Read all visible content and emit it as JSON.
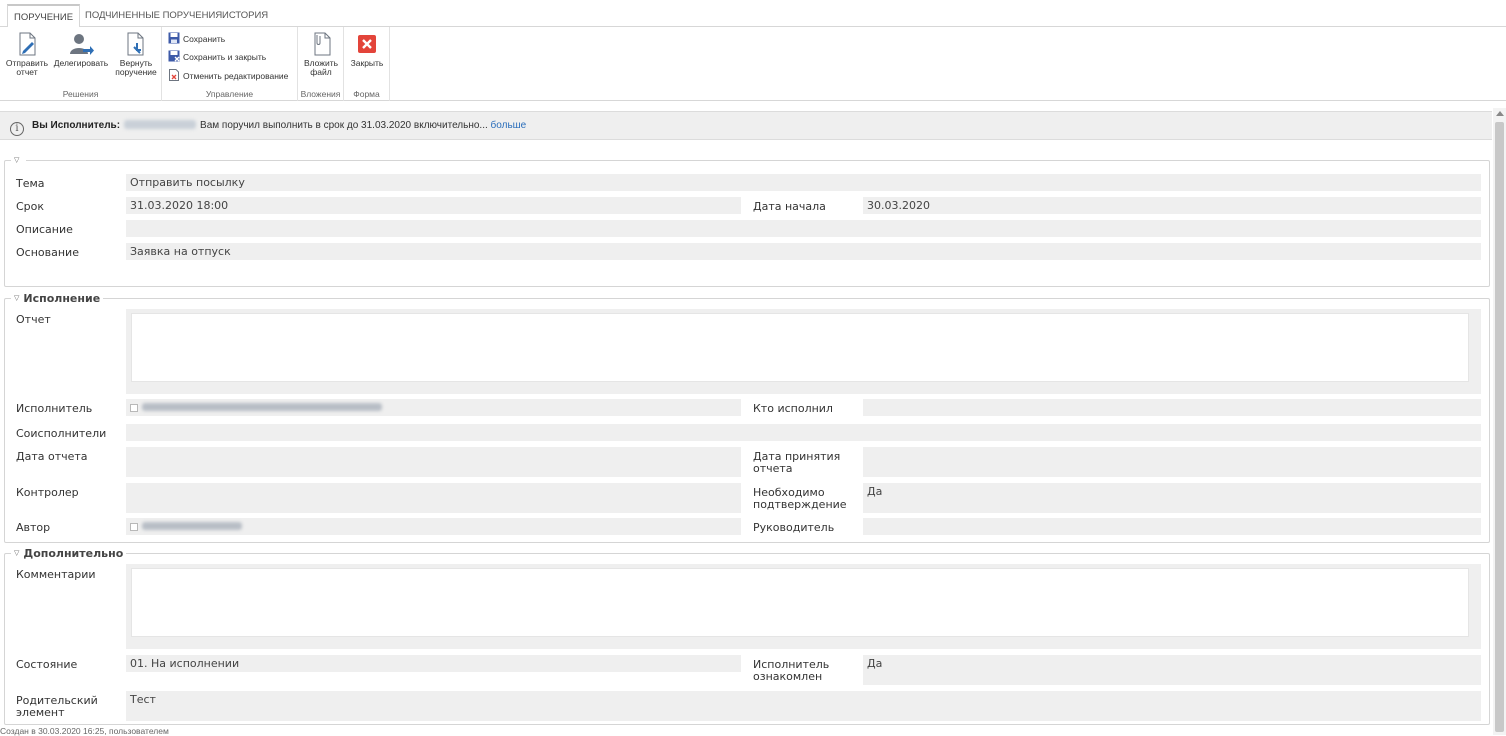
{
  "tabs": [
    {
      "label": "ПОРУЧЕНИЕ",
      "active": true
    },
    {
      "label": "ПОДЧИНЕННЫЕ ПОРУЧЕНИЯ",
      "active": false
    },
    {
      "label": "ИСТОРИЯ",
      "active": false
    }
  ],
  "ribbon": {
    "groups": {
      "decisions": "Решения",
      "management": "Управление",
      "attachments": "Вложения",
      "form": "Форма"
    },
    "send_report": "Отправить\nотчет",
    "delegate": "Делегировать",
    "return_task": "Вернуть\nпоручение",
    "save": "Сохранить",
    "save_close": "Сохранить и закрыть",
    "cancel_edit": "Отменить редактирование",
    "attach_file": "Вложить\nфайл",
    "close": "Закрыть",
    "colors": {
      "save_blue": "#3d5aa8",
      "close_red": "#e3443a",
      "icon_gray": "#6d7580",
      "icon_blue": "#2f6fb5"
    }
  },
  "infobar": {
    "prefix": "Вы Исполнитель:",
    "message": "Вам поручил выполнить в срок до 31.03.2020 включительно...",
    "more": "больше"
  },
  "main": {
    "fields": {
      "topic": {
        "label": "Тема",
        "value": "Отправить посылку"
      },
      "deadline": {
        "label": "Срок",
        "value": "31.03.2020 18:00"
      },
      "start_date": {
        "label": "Дата начала",
        "value": "30.03.2020"
      },
      "description": {
        "label": "Описание",
        "value": ""
      },
      "basis": {
        "label": "Основание",
        "value": "Заявка на отпуск"
      }
    }
  },
  "execution": {
    "title": "Исполнение",
    "report": "Отчет",
    "executor": "Исполнитель",
    "who_executed": "Кто исполнил",
    "co_executors": "Соисполнители",
    "report_date": "Дата отчета",
    "report_accept_date": "Дата принятия\nотчета",
    "controller": "Контролер",
    "confirmation_required": "Необходимо\nподтверждение",
    "confirmation_value": "Да",
    "author": "Автор",
    "manager": "Руководитель"
  },
  "additional": {
    "title": "Дополнительно",
    "comments": "Комментарии",
    "state": "Состояние",
    "state_value": "01. На исполнении",
    "executor_acquainted": "Исполнитель\nознакомлен",
    "executor_acquainted_value": "Да",
    "parent_element": "Родительский\nэлемент",
    "parent_element_value": "Тест"
  },
  "footer": "Создан в 30.03.2020 16:25, пользователем"
}
